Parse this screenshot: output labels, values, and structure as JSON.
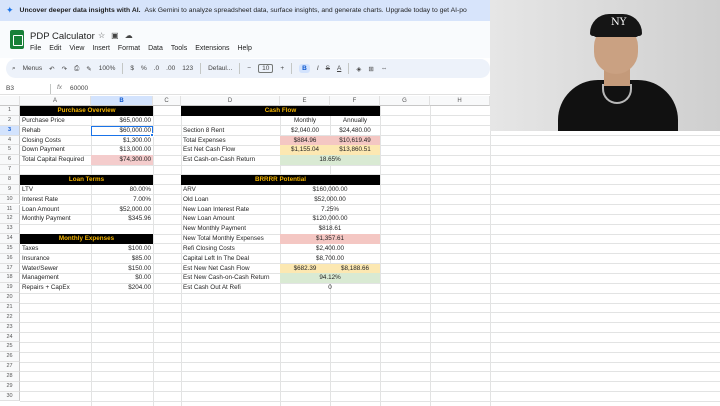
{
  "banner": {
    "bold": "Uncover deeper data insights with AI.",
    "text": "Ask Gemini to analyze spreadsheet data, surface insights, and generate charts. Upgrade today to get AI-po"
  },
  "doc": {
    "title": "PDP Calculator"
  },
  "menu": [
    "File",
    "Edit",
    "View",
    "Insert",
    "Format",
    "Data",
    "Tools",
    "Extensions",
    "Help"
  ],
  "toolbar": {
    "menus_label": "Menus",
    "zoom": "100%",
    "currency": "$",
    "percent": "%",
    "dec_less": ".0",
    "dec_more": ".00",
    "num_format": "123",
    "font": "Defaul...",
    "font_size": "10",
    "bold": "B"
  },
  "formula_bar": {
    "cell_ref": "B3",
    "fx": "fx",
    "value": "60000"
  },
  "columns": [
    "A",
    "B",
    "C",
    "D",
    "E",
    "F",
    "G",
    "H"
  ],
  "rows": [
    "1",
    "2",
    "3",
    "4",
    "5",
    "6",
    "7",
    "8",
    "9",
    "10",
    "11",
    "12",
    "13",
    "14",
    "15",
    "16",
    "17",
    "18",
    "19",
    "20",
    "21",
    "22",
    "23",
    "24",
    "25",
    "26",
    "27",
    "28",
    "29",
    "30"
  ],
  "purchase": {
    "header": "Purchase Overview",
    "rows": [
      {
        "label": "Purchase Price",
        "value": "$65,000.00"
      },
      {
        "label": "Rehab",
        "value": "$60,000.00"
      },
      {
        "label": "Closing Costs",
        "value": "$1,300.00"
      },
      {
        "label": "Down Payment",
        "value": "$13,000.00"
      },
      {
        "label": "Total Capital Required",
        "value": "$74,300.00"
      }
    ]
  },
  "loan": {
    "header": "Loan Terms",
    "rows": [
      {
        "label": "LTV",
        "value": "80.00%"
      },
      {
        "label": "Interest Rate",
        "value": "7.00%"
      },
      {
        "label": "Loan Amount",
        "value": "$52,000.00"
      },
      {
        "label": "Monthly Payment",
        "value": "$345.96"
      }
    ]
  },
  "expenses": {
    "header": "Monthly Expenses",
    "rows": [
      {
        "label": "Taxes",
        "value": "$100.00"
      },
      {
        "label": "Insurance",
        "value": "$85.00"
      },
      {
        "label": "Water/Sewer",
        "value": "$150.00"
      },
      {
        "label": "Management",
        "value": "$0.00"
      },
      {
        "label": "Repairs + CapEx",
        "value": "$204.00"
      }
    ]
  },
  "cashflow": {
    "header": "Cash Flow",
    "col_monthly": "Monthly",
    "col_annually": "Annually",
    "rows": [
      {
        "label": "Section 8 Rent",
        "monthly": "$2,040.00",
        "annually": "$24,480.00"
      },
      {
        "label": "Total Expenses",
        "monthly": "$884.96",
        "annually": "$10,619.49"
      },
      {
        "label": "Est Net Cash Flow",
        "monthly": "$1,155.04",
        "annually": "$13,860.51"
      },
      {
        "label": "Est Cash-on-Cash Return",
        "value": "18.65%"
      }
    ]
  },
  "brrrr": {
    "header": "BRRRR Potential",
    "rows": [
      {
        "label": "ARV",
        "value": "$160,000.00"
      },
      {
        "label": "Old Loan",
        "value": "$52,000.00"
      },
      {
        "label": "New Loan Interest Rate",
        "value": "7.25%"
      },
      {
        "label": "New Loan Amount",
        "value": "$120,000.00"
      },
      {
        "label": "New Monthly Payment",
        "value": "$818.61"
      },
      {
        "label": "New Total Monthly Expenses",
        "value": "$1,357.61"
      },
      {
        "label": "Refi Closing Costs",
        "value": "$2,400.00"
      },
      {
        "label": "Capital Left In The Deal",
        "value": "$8,700.00"
      },
      {
        "label": "Est New Net Cash Flow",
        "monthly": "$682.39",
        "annually": "$8,188.66"
      },
      {
        "label": "Est New Cash-on-Cash Return",
        "value": "94.12%"
      },
      {
        "label": "Est Cash Out At Refi",
        "value": "0"
      }
    ]
  },
  "colors": {
    "header_bg": "#000000",
    "header_text": "#f4b400",
    "red": "#f4c7c3",
    "yellow": "#fce8b2",
    "green": "#d9ead3",
    "accent": "#1a73e8"
  },
  "icons": [
    "sparkle-icon",
    "star-icon",
    "move-to-folder-icon",
    "cloud-status-icon",
    "undo-icon",
    "redo-icon",
    "print-icon",
    "paint-format-icon",
    "fill-color-icon",
    "borders-icon"
  ]
}
